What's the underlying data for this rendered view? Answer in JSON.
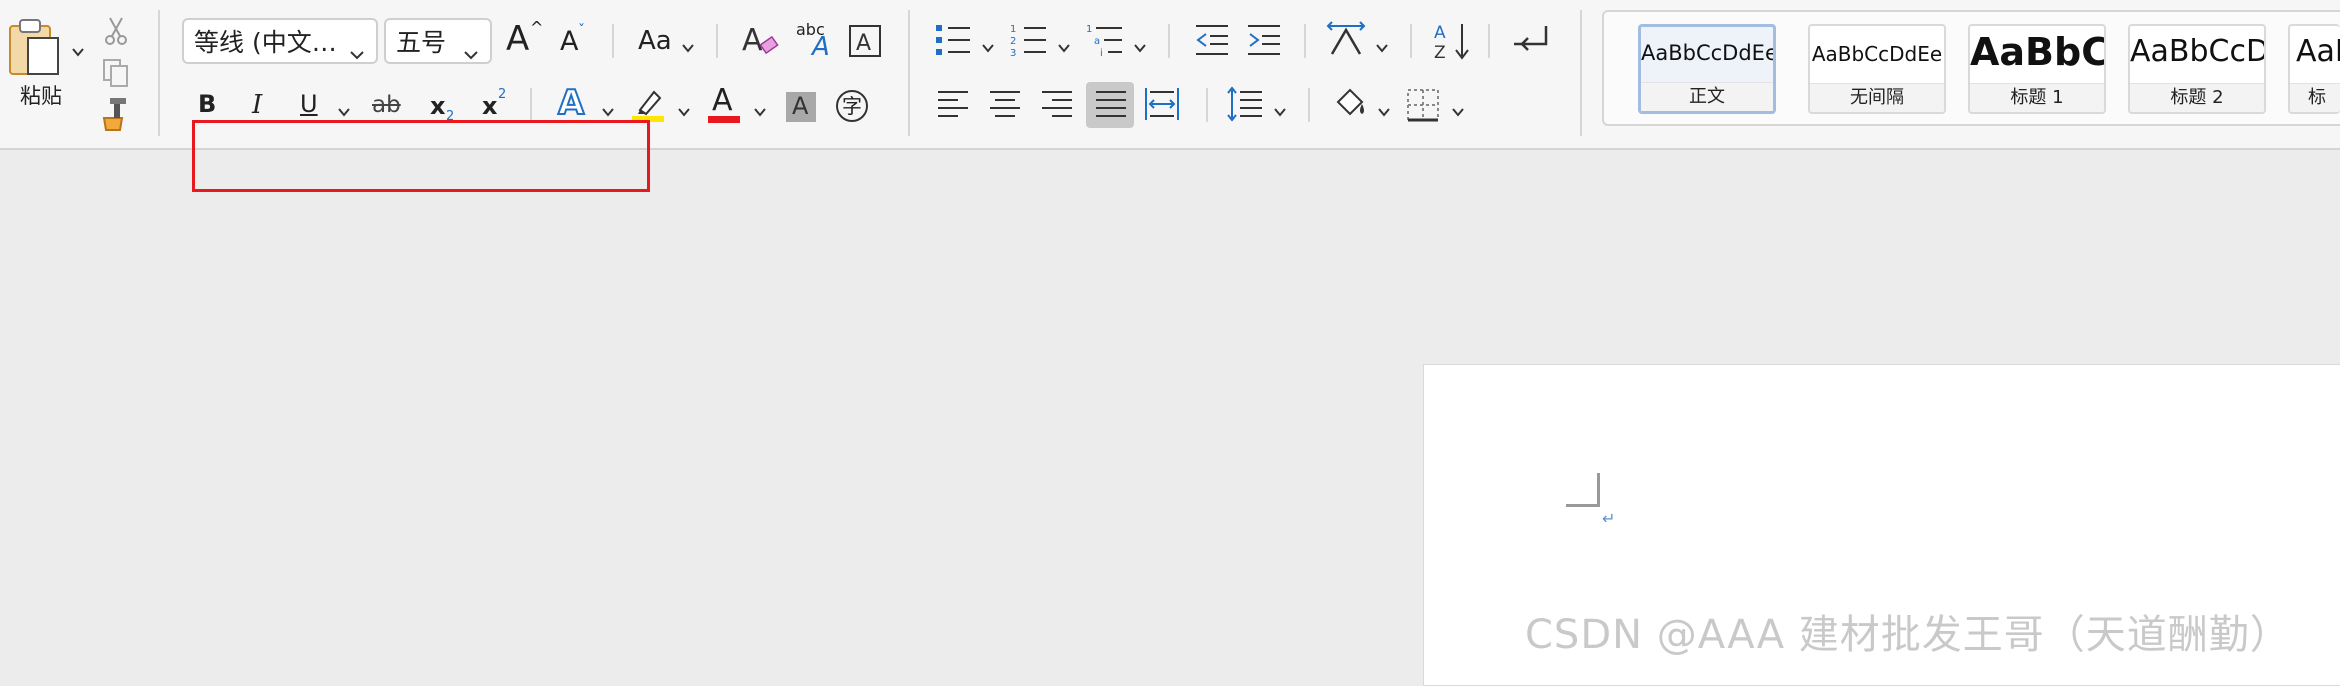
{
  "clipboard": {
    "paste_label": "粘贴"
  },
  "font": {
    "name": "等线 (中文…",
    "size": "五号",
    "change_case_label": "Aa",
    "grow_label": "A",
    "shrink_label": "A",
    "phonetic_label": "abc",
    "enclosed_label": "A"
  },
  "format": {
    "bold": "B",
    "italic": "I",
    "underline": "U",
    "strike": "ab",
    "subscript": "x",
    "subscript_mark": "2",
    "superscript": "x",
    "superscript_mark": "2",
    "text_effect": "A",
    "font_color": "A",
    "shading": "A",
    "enclose": "字"
  },
  "colors": {
    "highlight": "#ffe600",
    "font_color": "#e8191e",
    "accent_blue": "#1f6fc5",
    "annotation_red": "#e8191e"
  },
  "styles": [
    {
      "preview": "AaBbCcDdEe",
      "name": "正文",
      "selected": true
    },
    {
      "preview": "AaBbCcDdEe",
      "name": "无间隔",
      "selected": false
    },
    {
      "preview": "AaBbC",
      "name": "标题 1",
      "selected": false
    },
    {
      "preview": "AaBbCcD",
      "name": "标题 2",
      "selected": false
    },
    {
      "preview": "AaB",
      "name": "标",
      "selected": false
    }
  ],
  "document": {
    "paragraph_mark": "↵"
  },
  "watermark": "CSDN @AAA 建材批发王哥（天道酬勤）"
}
